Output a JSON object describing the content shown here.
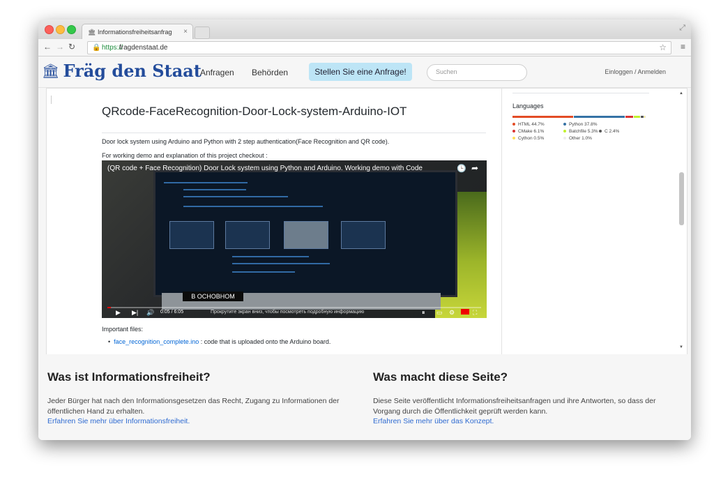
{
  "browser": {
    "tab_title": "Informationsfreiheitsanfrag",
    "url_scheme": "https://",
    "url_host": "fragdenstaat.de"
  },
  "site": {
    "logo_text": "Fräg den Staat",
    "nav": [
      "Anfragen",
      "Behörden"
    ],
    "cta": "Stellen Sie eine Anfrage!",
    "search_placeholder": "Suchen",
    "login": "Einloggen / Anmelden"
  },
  "repo": {
    "title": "QRcode-FaceRecognition-Door-Lock-system-Arduino-IOT",
    "description": "Door lock system using Arduino and Python with 2 step authentication(Face Recognition and QR code).",
    "demo_text": "For working demo and explanation of this project checkout :",
    "important_label": "Important files:",
    "files": [
      {
        "name": "face_recognition_complete.ino",
        "desc": ": code that is uploaded onto the Arduino board."
      }
    ]
  },
  "video": {
    "title": "(QR code + Face Recognition) Door Lock system using Python and Arduino. Working demo with Code",
    "banner": "В ОСНОВНОМ",
    "time": "0:05 / 6:05",
    "caption": "Прокрутите экран вниз, чтобы посмотреть подробную информацию",
    "progress": 0.01
  },
  "languages": {
    "title": "Languages",
    "items": [
      {
        "name": "HTML",
        "percent": "44.7%",
        "color": "#e34c26"
      },
      {
        "name": "Python",
        "percent": "37.8%",
        "color": "#3572A5"
      },
      {
        "name": "CMake",
        "percent": "6.1%",
        "color": "#DA3434"
      },
      {
        "name": "Batchfile",
        "percent": "5.3%",
        "color": "#C1F12E"
      },
      {
        "name": "C",
        "percent": "2.4%",
        "color": "#555555"
      },
      {
        "name": "Cython",
        "percent": "0.5%",
        "color": "#fedf5b"
      },
      {
        "name": "Other",
        "percent": "1.0%",
        "color": "#ededed"
      }
    ]
  },
  "footer": {
    "left_heading": "Was ist Informationsfreiheit?",
    "left_text": "Jeder Bürger hat nach den Informationsgesetzen das Recht, Zugang zu Informationen der öffentlichen Hand zu erhalten.",
    "left_link": "Erfahren Sie mehr über Informationsfreiheit.",
    "right_heading": "Was macht diese Seite?",
    "right_text": "Diese Seite veröffentlicht Informationsfreiheitsanfragen und ihre Antworten, so dass der Vorgang durch die Öffentlichkeit geprüft werden kann.",
    "right_link": "Erfahren Sie mehr über das Konzept."
  }
}
